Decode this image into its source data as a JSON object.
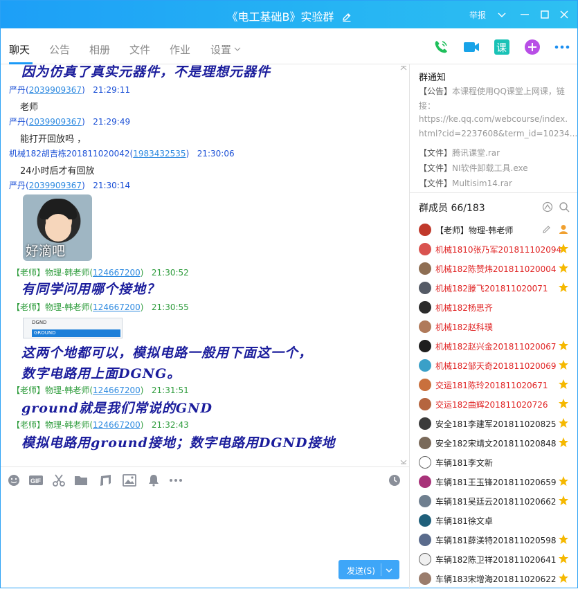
{
  "window": {
    "title": "《电工基础B》实验群",
    "report_label": "举报"
  },
  "tabs": [
    {
      "label": "聊天"
    },
    {
      "label": "公告"
    },
    {
      "label": "相册"
    },
    {
      "label": "文件"
    },
    {
      "label": "作业"
    },
    {
      "label": "设置"
    }
  ],
  "top_actions": {
    "class_label": "课"
  },
  "messages": [
    {
      "type": "big",
      "text": "因为仿真了真实元器件，不是理想元器件"
    },
    {
      "type": "meta",
      "name": "严丹",
      "uid": "2039909367",
      "time": "21:29:11"
    },
    {
      "type": "text",
      "text": "老师"
    },
    {
      "type": "meta",
      "name": "严丹",
      "uid": "2039909367",
      "time": "21:29:49"
    },
    {
      "type": "text",
      "text": "能打开回放吗 ，"
    },
    {
      "type": "meta",
      "name": "机械182胡吉栋201811020042",
      "uid": "1983432535",
      "time": "21:30:06"
    },
    {
      "type": "text",
      "text": "24小时后才有回放"
    },
    {
      "type": "meta",
      "name": "严丹",
      "uid": "2039909367",
      "time": "21:30:14"
    },
    {
      "type": "sticker",
      "text": "好滴吧"
    },
    {
      "type": "meta-teacher",
      "role": "【老师】",
      "name": "物理-韩老师",
      "uid": "124667200",
      "time": "21:30:52"
    },
    {
      "type": "big",
      "text": "有同学问用哪个接地？"
    },
    {
      "type": "meta-teacher",
      "role": "【老师】",
      "name": "物理-韩老师",
      "uid": "124667200",
      "time": "21:30:55"
    },
    {
      "type": "image",
      "row1": "DGND",
      "row2": "GROUND"
    },
    {
      "type": "big",
      "text": " 这两个地都可以，模拟电路一般用下面这一个，"
    },
    {
      "type": "big",
      "text": "数字电路用上面DGNG。"
    },
    {
      "type": "meta-teacher",
      "role": "【老师】",
      "name": "物理-韩老师",
      "uid": "124667200",
      "time": "21:31:51"
    },
    {
      "type": "big",
      "text": "ground就是我们常说的GND"
    },
    {
      "type": "meta-teacher",
      "role": "【老师】",
      "name": "物理-韩老师",
      "uid": "124667200",
      "time": "21:32:43"
    },
    {
      "type": "big",
      "text": "模拟电路用ground接地；数字电路用DGND接地"
    }
  ],
  "input": {
    "send_label": "发送(S)"
  },
  "notice": {
    "title": "群通知",
    "lines": [
      {
        "tag": "【公告】",
        "text": "本课程使用QQ课堂上网课，链"
      },
      {
        "tag": "",
        "text": "接："
      },
      {
        "tag": "",
        "text": "https://ke.qq.com/webcourse/index."
      },
      {
        "tag": "",
        "text": "html?cid=2237608&term_id=10234..."
      },
      {
        "tag": "【文件】",
        "text": "腾讯课堂.rar"
      },
      {
        "tag": "【文件】",
        "text": "NI软件卸载工具.exe"
      },
      {
        "tag": "【文件】",
        "text": "Multisim14.rar"
      }
    ]
  },
  "members": {
    "title": "群成员 66/183",
    "list": [
      {
        "name": "【老师】物理-韩老师",
        "color": "dark",
        "avatar": "#c0392b",
        "badge": "teacher"
      },
      {
        "name": "机械1810张乃军201811102094",
        "color": "red",
        "avatar": "#d9534f",
        "badge": "star"
      },
      {
        "name": "机械182陈赞炜201811020004",
        "color": "red",
        "avatar": "#8e6e53",
        "badge": "star"
      },
      {
        "name": "机械182滕飞201811020071",
        "color": "red",
        "avatar": "#555b66",
        "badge": "star"
      },
      {
        "name": "机械182杨思齐",
        "color": "red",
        "avatar": "#2c2c2c",
        "badge": ""
      },
      {
        "name": "机械182赵科璞",
        "color": "red",
        "avatar": "#b07a5a",
        "badge": ""
      },
      {
        "name": "机械182赵兴金201811020067",
        "color": "red",
        "avatar": "#1e1e1e",
        "badge": "star"
      },
      {
        "name": "机械182邹天奇201811020069",
        "color": "red",
        "avatar": "#3aa0c8",
        "badge": "star"
      },
      {
        "name": "交运181陈玲201811020671",
        "color": "red",
        "avatar": "#c9703d",
        "badge": "star"
      },
      {
        "name": "交运182曲辉201811020726",
        "color": "red",
        "avatar": "#b5653f",
        "badge": "star"
      },
      {
        "name": "安全181李建军201811020825",
        "color": "dark",
        "avatar": "#3b3b3b",
        "badge": "star"
      },
      {
        "name": "安全182宋靖文201811020848",
        "color": "dark",
        "avatar": "#7a6a5a",
        "badge": "star"
      },
      {
        "name": "车辆181李文新",
        "color": "dark",
        "avatar": "#ffffff",
        "badge": ""
      },
      {
        "name": "车辆181王玉锋201811020659",
        "color": "dark",
        "avatar": "#a83279",
        "badge": "star"
      },
      {
        "name": "车辆181吴廷云201811020662",
        "color": "dark",
        "avatar": "#6f7f8f",
        "badge": "star"
      },
      {
        "name": "车辆181徐文卓",
        "color": "dark",
        "avatar": "#1f5f7a",
        "badge": ""
      },
      {
        "name": "车辆181薛渼特201811020598",
        "color": "dark",
        "avatar": "#5a6b8c",
        "badge": "star"
      },
      {
        "name": "车辆182陈卫祥201811020641",
        "color": "dark",
        "avatar": "#f0f0f0",
        "badge": "star"
      },
      {
        "name": "车辆183宋增海201811020622",
        "color": "dark",
        "avatar": "#9a7c6c",
        "badge": "star"
      }
    ]
  }
}
